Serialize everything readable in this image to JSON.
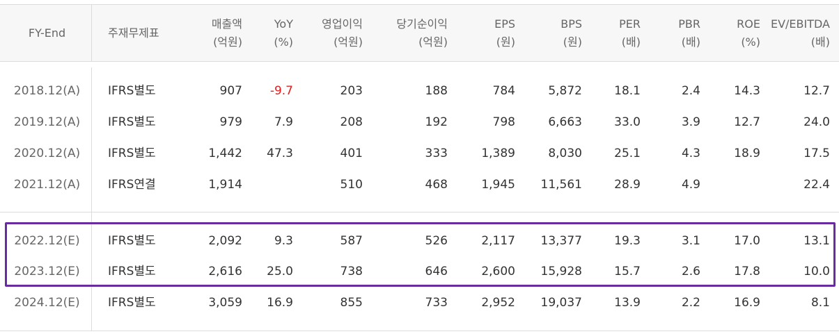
{
  "columns": [
    {
      "label": "FY-End",
      "unit": ""
    },
    {
      "label": "주재무제표",
      "unit": ""
    },
    {
      "label": "매출액",
      "unit": "(억원)"
    },
    {
      "label": "YoY",
      "unit": "(%)"
    },
    {
      "label": "영업이익",
      "unit": "(억원)"
    },
    {
      "label": "당기순이익",
      "unit": "(억원)"
    },
    {
      "label": "EPS",
      "unit": "(원)"
    },
    {
      "label": "BPS",
      "unit": "(원)"
    },
    {
      "label": "PER",
      "unit": "(배)"
    },
    {
      "label": "PBR",
      "unit": "(배)"
    },
    {
      "label": "ROE",
      "unit": "(%)"
    },
    {
      "label": "EV/EBITDA",
      "unit": "(배)"
    }
  ],
  "rows": [
    [
      "2018.12(A)",
      "IFRS별도",
      "907",
      "-9.7",
      "203",
      "188",
      "784",
      "5,872",
      "18.1",
      "2.4",
      "14.3",
      "12.7"
    ],
    [
      "2019.12(A)",
      "IFRS별도",
      "979",
      "7.9",
      "208",
      "192",
      "798",
      "6,663",
      "33.0",
      "3.9",
      "12.7",
      "24.0"
    ],
    [
      "2020.12(A)",
      "IFRS별도",
      "1,442",
      "47.3",
      "401",
      "333",
      "1,389",
      "8,030",
      "25.1",
      "4.3",
      "18.9",
      "17.5"
    ],
    [
      "2021.12(A)",
      "IFRS연결",
      "1,914",
      "",
      "510",
      "468",
      "1,945",
      "11,561",
      "28.9",
      "4.9",
      "",
      "22.4"
    ],
    [
      "2022.12(E)",
      "IFRS별도",
      "2,092",
      "9.3",
      "587",
      "526",
      "2,117",
      "13,377",
      "19.3",
      "3.1",
      "17.0",
      "13.1"
    ],
    [
      "2023.12(E)",
      "IFRS별도",
      "2,616",
      "25.0",
      "738",
      "646",
      "2,600",
      "15,928",
      "15.7",
      "2.6",
      "17.8",
      "10.0"
    ],
    [
      "2024.12(E)",
      "IFRS별도",
      "3,059",
      "16.9",
      "855",
      "733",
      "2,952",
      "19,037",
      "13.9",
      "2.2",
      "16.9",
      "8.1"
    ]
  ],
  "colors": {
    "header_bg": "#f7f7f7",
    "negative": "#e02020",
    "highlight_border": "#6a2aa0",
    "grid_line": "#dcdcdc"
  }
}
